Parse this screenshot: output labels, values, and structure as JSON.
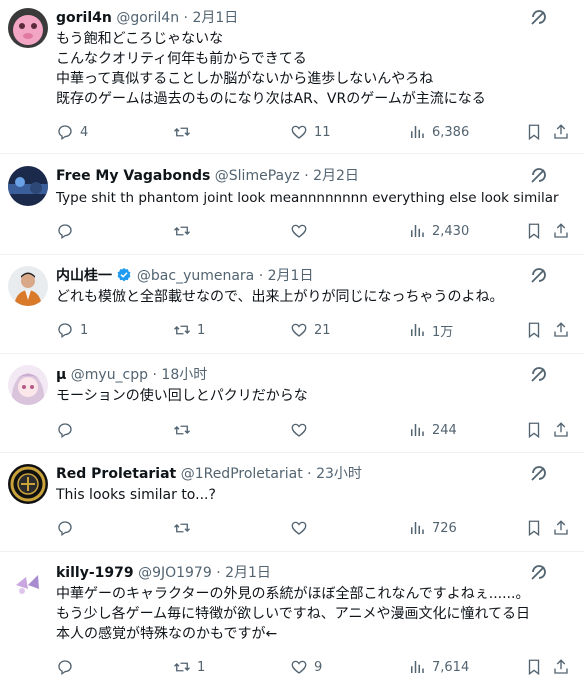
{
  "tweets": [
    {
      "name": "goril4n",
      "handle": "@goril4n",
      "sep": "·",
      "time": "2月1日",
      "lines": [
        "もう飽和どころじゃないな",
        "こんなクオリティ何年も前からできてる",
        "中華って真似することしか脳がないから進歩しないんやろね",
        "既存のゲームは過去のものになり次はAR、VRのゲームが主流になる"
      ],
      "replies": "4",
      "retweets": "",
      "likes": "11",
      "views": "6,386"
    },
    {
      "name": "Free My Vagabonds",
      "handle": "@SlimePayz",
      "sep": "·",
      "time": "2月2日",
      "lines": [
        "Type shit th phantom joint look meannnnnnnn everything else  look similar"
      ],
      "replies": "",
      "retweets": "",
      "likes": "",
      "views": "2,430"
    },
    {
      "name": "内山桂一",
      "handle": "@bac_yumenara",
      "sep": "·",
      "time": "2月1日",
      "verified": true,
      "lines": [
        "どれも模倣と全部載せなので、出来上がりが同じになっちゃうのよね。"
      ],
      "replies": "1",
      "retweets": "1",
      "likes": "21",
      "views": "1万"
    },
    {
      "name": "μ",
      "handle": "@myu_cpp",
      "sep": "·",
      "time": "18小时",
      "lines": [
        "モーションの使い回しとパクリだからな"
      ],
      "replies": "",
      "retweets": "",
      "likes": "",
      "views": "244"
    },
    {
      "name": "Red Proletariat",
      "handle": "@1RedProletariat",
      "sep": "·",
      "time": "23小时",
      "lines": [
        "This looks similar to...?"
      ],
      "replies": "",
      "retweets": "",
      "likes": "",
      "views": "726"
    },
    {
      "name": "killy-1979",
      "handle": "@9JO1979",
      "sep": "·",
      "time": "2月1日",
      "lines": [
        "中華ゲーのキャラクターの外見の系統がほぼ全部これなんですよねぇ......。",
        "もう少し各ゲーム毎に特徴が欲しいですね、アニメや漫画文化に憧れてる日",
        "本人の感覚が特殊なのかもですが←"
      ],
      "replies": "",
      "retweets": "1",
      "likes": "9",
      "views": "7,614"
    }
  ],
  "colors": {
    "text": "#0f1419",
    "secondary": "#536471",
    "divider": "#eff3f4",
    "verified": "#1d9bf0"
  },
  "icons": {
    "reply": "reply-icon",
    "retweet": "retweet-icon",
    "like": "heart-icon",
    "views": "views-chart-icon",
    "bookmark": "bookmark-icon",
    "share": "share-icon",
    "menu": "grok-slash-icon"
  }
}
